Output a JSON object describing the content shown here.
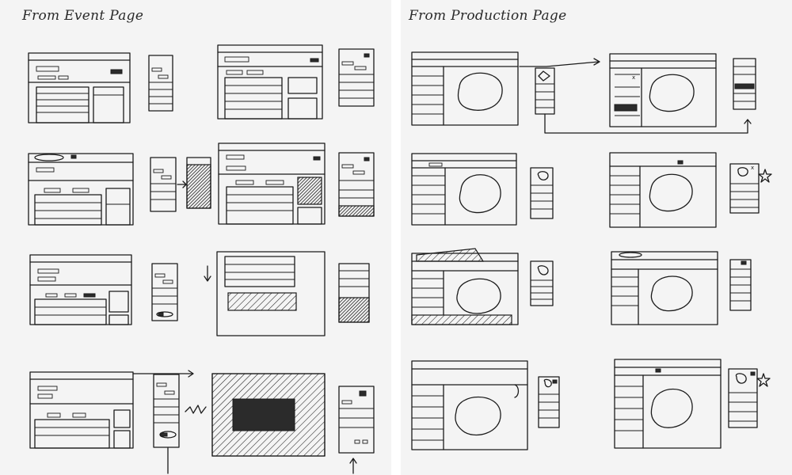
{
  "left_page": {
    "title": "From Event Page"
  },
  "right_page": {
    "title": "From Production Page"
  },
  "colors": {
    "paper": "#f4f4f4",
    "ink": "#1b1b1b",
    "gutter": "#ffffff"
  }
}
